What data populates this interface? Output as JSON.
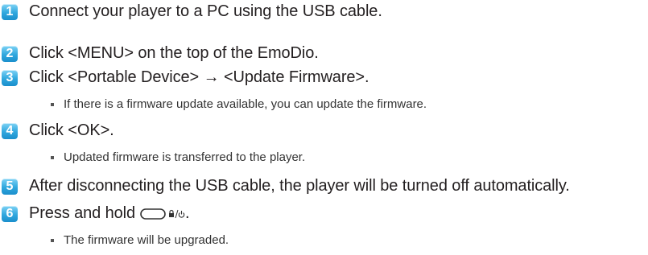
{
  "steps": [
    {
      "number": "1",
      "text": "Connect your player to a PC using the USB cable."
    },
    {
      "number": "2",
      "text": "Click <MENU> on the top of the EmoDio."
    },
    {
      "number": "3",
      "text": "Click <Portable Device> → <Update Firmware>.",
      "note": "If there is a firmware update available, you can update the firmware."
    },
    {
      "number": "4",
      "text": "Click <OK>.",
      "note": "Updated firmware is transferred to the player."
    },
    {
      "number": "5",
      "text": "After disconnecting the USB cable, the player will be turned off automatically."
    },
    {
      "number": "6",
      "text": "Press and hold",
      "text_suffix": ".",
      "button_icon": "lock-power-button-icon",
      "note": "The firmware will be upgraded."
    }
  ],
  "colors": {
    "badge": "#2fa7de",
    "text": "#231f20"
  }
}
